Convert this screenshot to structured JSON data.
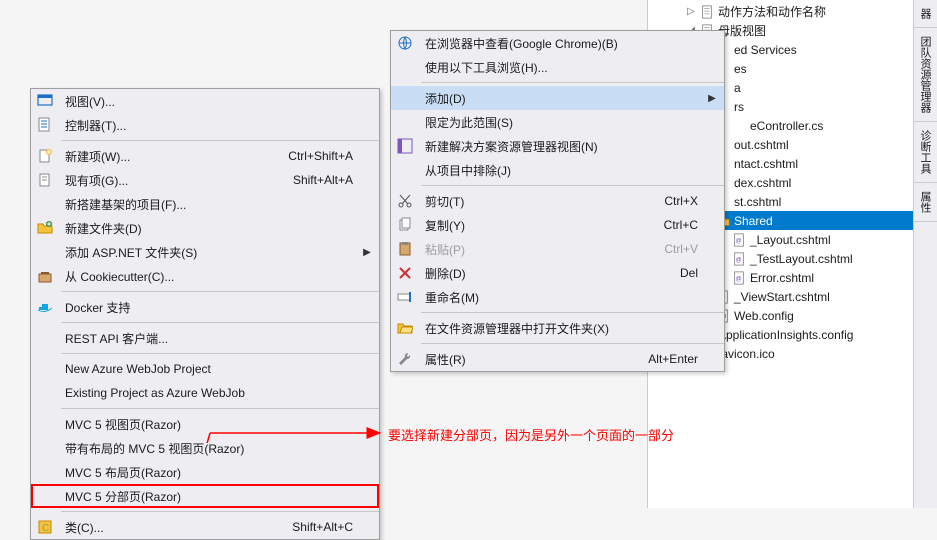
{
  "menu1": {
    "items": [
      {
        "icon": "view",
        "label": "视图(V)...",
        "shortcut": "",
        "sub": false
      },
      {
        "icon": "controller",
        "label": "控制器(T)...",
        "shortcut": "",
        "sub": false
      },
      {
        "sep": true
      },
      {
        "icon": "newitem",
        "label": "新建项(W)...",
        "shortcut": "Ctrl+Shift+A",
        "sub": false
      },
      {
        "icon": "existitem",
        "label": "现有项(G)...",
        "shortcut": "Shift+Alt+A",
        "sub": false
      },
      {
        "icon": "",
        "label": "新搭建基架的项目(F)...",
        "shortcut": "",
        "sub": false
      },
      {
        "icon": "newfolder",
        "label": "新建文件夹(D)",
        "shortcut": "",
        "sub": false
      },
      {
        "icon": "",
        "label": "添加 ASP.NET 文件夹(S)",
        "shortcut": "",
        "sub": true
      },
      {
        "icon": "cookie",
        "label": "从 Cookiecutter(C)...",
        "shortcut": "",
        "sub": false
      },
      {
        "sep": true
      },
      {
        "icon": "docker",
        "label": "Docker 支持",
        "shortcut": "",
        "sub": false
      },
      {
        "sep": true
      },
      {
        "icon": "",
        "label": "REST API 客户端...",
        "shortcut": "",
        "sub": false
      },
      {
        "sep": true
      },
      {
        "icon": "",
        "label": "New Azure WebJob Project",
        "shortcut": "",
        "sub": false
      },
      {
        "icon": "",
        "label": "Existing Project as Azure WebJob",
        "shortcut": "",
        "sub": false
      },
      {
        "sep": true
      },
      {
        "icon": "",
        "label": "MVC 5 视图页(Razor)",
        "shortcut": "",
        "sub": false
      },
      {
        "icon": "",
        "label": "带有布局的 MVC 5 视图页(Razor)",
        "shortcut": "",
        "sub": false
      },
      {
        "icon": "",
        "label": "MVC 5 布局页(Razor)",
        "shortcut": "",
        "sub": false
      },
      {
        "icon": "",
        "label": "MVC 5 分部页(Razor)",
        "shortcut": "",
        "sub": false,
        "redbox": true
      },
      {
        "sep": true
      },
      {
        "icon": "class",
        "label": "类(C)...",
        "shortcut": "Shift+Alt+C",
        "sub": false
      }
    ]
  },
  "menu2": {
    "items": [
      {
        "icon": "browser",
        "label": "在浏览器中查看(Google Chrome)(B)",
        "shortcut": "",
        "sub": false
      },
      {
        "icon": "",
        "label": "使用以下工具浏览(H)...",
        "shortcut": "",
        "sub": false
      },
      {
        "sep": true
      },
      {
        "icon": "",
        "label": "添加(D)",
        "shortcut": "",
        "sub": true,
        "highlighted": true
      },
      {
        "icon": "",
        "label": "限定为此范围(S)",
        "shortcut": "",
        "sub": false
      },
      {
        "icon": "solview",
        "label": "新建解决方案资源管理器视图(N)",
        "shortcut": "",
        "sub": false
      },
      {
        "icon": "",
        "label": "从项目中排除(J)",
        "shortcut": "",
        "sub": false
      },
      {
        "sep": true
      },
      {
        "icon": "cut",
        "label": "剪切(T)",
        "shortcut": "Ctrl+X",
        "sub": false
      },
      {
        "icon": "copy",
        "label": "复制(Y)",
        "shortcut": "Ctrl+C",
        "sub": false
      },
      {
        "icon": "paste",
        "label": "粘贴(P)",
        "shortcut": "Ctrl+V",
        "sub": false,
        "disabled": true
      },
      {
        "icon": "delete",
        "label": "删除(D)",
        "shortcut": "Del",
        "sub": false
      },
      {
        "icon": "rename",
        "label": "重命名(M)",
        "shortcut": "",
        "sub": false
      },
      {
        "sep": true
      },
      {
        "icon": "openfolder",
        "label": "在文件资源管理器中打开文件夹(X)",
        "shortcut": "",
        "sub": false
      },
      {
        "sep": true
      },
      {
        "icon": "wrench",
        "label": "属性(R)",
        "shortcut": "Alt+Enter",
        "sub": false
      }
    ]
  },
  "tree": {
    "items": [
      {
        "indent": 2,
        "exp": "▷",
        "icon": "doc",
        "label": "动作方法和动作名称"
      },
      {
        "indent": 2,
        "exp": "◢",
        "icon": "doc",
        "label": "母版视图"
      },
      {
        "indent": 3,
        "exp": "",
        "icon": "",
        "label": "ed Services",
        "partial": true
      },
      {
        "indent": 3,
        "exp": "",
        "icon": "",
        "label": "es",
        "partial": true
      },
      {
        "indent": 3,
        "exp": "",
        "icon": "",
        "label": "a",
        "partial": true
      },
      {
        "indent": 3,
        "exp": "",
        "icon": "",
        "label": "rs",
        "partial": true
      },
      {
        "indent": 4,
        "exp": "",
        "icon": "",
        "label": "eController.cs",
        "partial": true
      },
      {
        "indent": 3,
        "exp": "",
        "icon": "",
        "label": "out.cshtml",
        "partial": true
      },
      {
        "indent": 3,
        "exp": "",
        "icon": "",
        "label": "ntact.cshtml",
        "partial": true
      },
      {
        "indent": 3,
        "exp": "",
        "icon": "",
        "label": "dex.cshtml",
        "partial": true
      },
      {
        "indent": 3,
        "exp": "",
        "icon": "",
        "label": "st.cshtml",
        "partial": true
      },
      {
        "indent": 3,
        "exp": "◢",
        "icon": "folder",
        "label": "Shared",
        "selected": true
      },
      {
        "indent": 4,
        "exp": "",
        "icon": "cshtml",
        "label": "_Layout.cshtml"
      },
      {
        "indent": 4,
        "exp": "",
        "icon": "cshtml",
        "label": "_TestLayout.cshtml"
      },
      {
        "indent": 4,
        "exp": "",
        "icon": "cshtml",
        "label": "Error.cshtml"
      },
      {
        "indent": 3,
        "exp": "",
        "icon": "cshtml",
        "label": "_ViewStart.cshtml"
      },
      {
        "indent": 3,
        "exp": "",
        "icon": "config",
        "label": "Web.config"
      },
      {
        "indent": 2,
        "exp": "▷",
        "icon": "config",
        "label": "ApplicationInsights.config"
      },
      {
        "indent": 2,
        "exp": "",
        "icon": "ico",
        "label": "favicon.ico"
      }
    ]
  },
  "annotation": {
    "text": "要选择新建分部页，因为是另外一个页面的一部分"
  },
  "side_tabs": [
    "器",
    "团队资源管理器",
    "诊断工具",
    "属性"
  ]
}
